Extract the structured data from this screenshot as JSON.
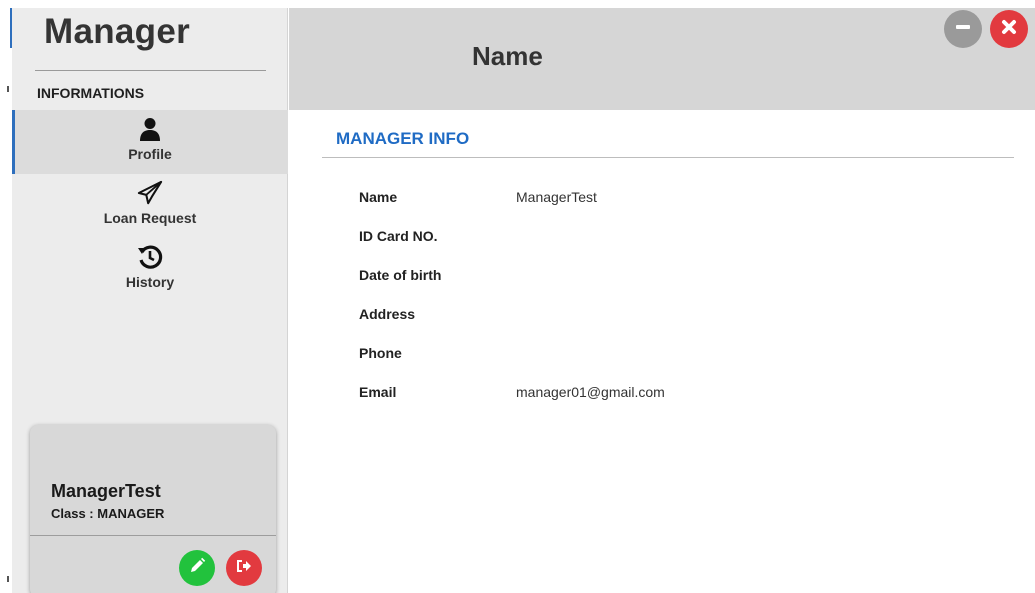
{
  "sidebar": {
    "brand": "Manager",
    "section_label": "INFORMATIONS",
    "items": [
      {
        "label": "Profile",
        "icon": "user-icon",
        "active": true
      },
      {
        "label": "Loan Request",
        "icon": "paper-plane-icon",
        "active": false
      },
      {
        "label": "History",
        "icon": "history-icon",
        "active": false
      }
    ]
  },
  "user_card": {
    "name": "ManagerTest",
    "class_text": "Class : MANAGER",
    "edit_icon": "pencil-icon",
    "logout_icon": "sign-out-icon"
  },
  "header": {
    "title": "Name",
    "minimize_icon": "minimize-icon",
    "close_icon": "close-icon"
  },
  "main": {
    "heading": "MANAGER INFO",
    "fields": [
      {
        "label": "Name",
        "value": "ManagerTest"
      },
      {
        "label": "ID Card NO.",
        "value": ""
      },
      {
        "label": "Date of birth",
        "value": ""
      },
      {
        "label": "Address",
        "value": ""
      },
      {
        "label": "Phone",
        "value": ""
      },
      {
        "label": "Email",
        "value": "manager01@gmail.com"
      }
    ]
  },
  "colors": {
    "accent": "#2e6fbd",
    "heading_blue": "#1f6bc4",
    "edit_green": "#22c23d",
    "danger_red": "#e23a3f",
    "minimize_gray": "#9a9a9a"
  }
}
